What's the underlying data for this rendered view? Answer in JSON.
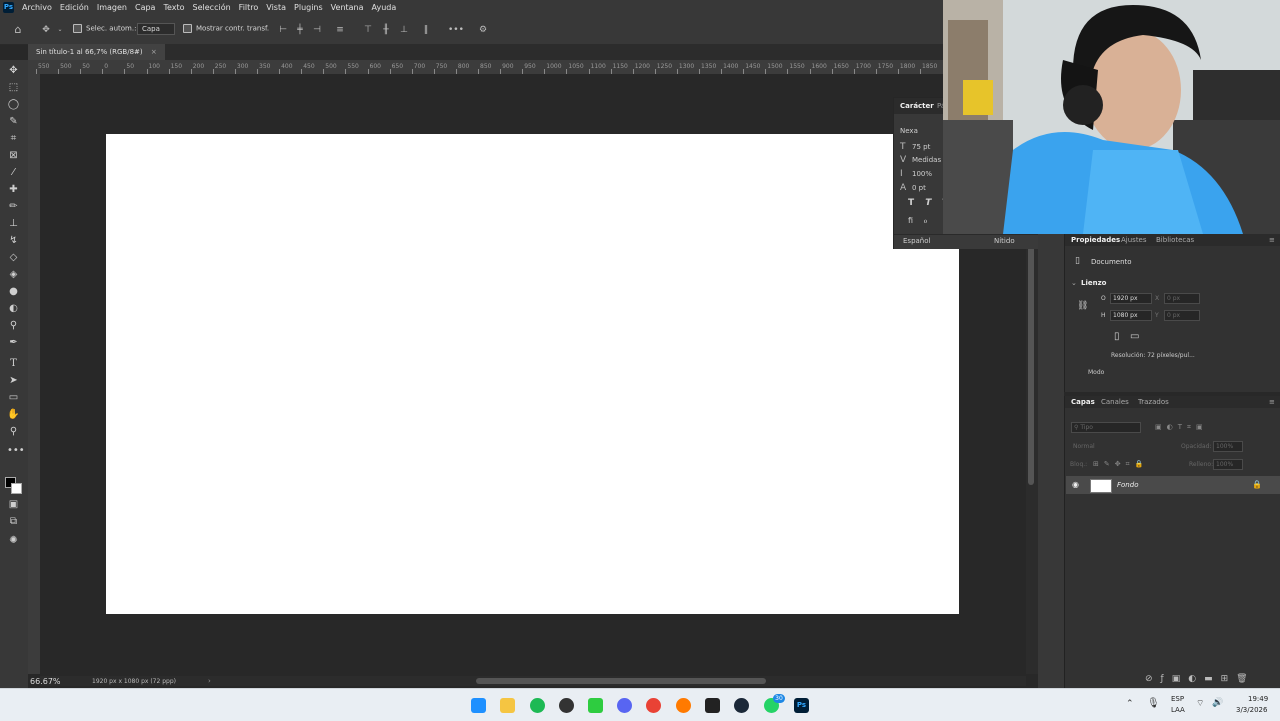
{
  "menubar": {
    "app_icon": "Ps",
    "items": [
      "Archivo",
      "Edición",
      "Imagen",
      "Capa",
      "Texto",
      "Selección",
      "Filtro",
      "Vista",
      "Plugins",
      "Ventana",
      "Ayuda"
    ]
  },
  "options_bar": {
    "auto_select_label": "Selec. autom.:",
    "auto_select_target": "Capa",
    "show_transform_label": "Mostrar contr. transf."
  },
  "document": {
    "tab_title": "Sin título-1 al 66,7% (RGB/8#)",
    "zoom": "66.67%",
    "info": "1920 px x 1080 px (72 ppp)"
  },
  "ruler_labels": [
    "550",
    "500",
    "50",
    "0",
    "50",
    "100",
    "150",
    "200",
    "250",
    "300",
    "350",
    "400",
    "450",
    "500",
    "550",
    "600",
    "650",
    "700",
    "750",
    "800",
    "850",
    "900",
    "950",
    "1000",
    "1050",
    "1100",
    "1150",
    "1200",
    "1250",
    "1300",
    "1350",
    "1400",
    "1450",
    "1500",
    "1550",
    "1600",
    "1650",
    "1700",
    "1750",
    "1800",
    "1850"
  ],
  "character_panel": {
    "tabs": [
      "Carácter",
      "Pá"
    ],
    "font": "Nexa",
    "size": "75 pt",
    "kerning": "Medidas",
    "vertical_scale": "100%",
    "baseline": "0 pt",
    "language": "Español",
    "antialias": "Nítido"
  },
  "properties_panel": {
    "tabs": [
      "Propiedades",
      "Ajustes",
      "Bibliotecas"
    ],
    "doc_label": "Documento",
    "section": "Lienzo",
    "width_label": "O",
    "width": "1920 px",
    "height_label": "H",
    "height": "1080 px",
    "x_label": "X",
    "x_value": "0 px",
    "y_label": "Y",
    "y_value": "0 px",
    "resolution": "Resolución: 72 píxeles/pul...",
    "mode": "Modo"
  },
  "layers_panel": {
    "tabs": [
      "Capas",
      "Canales",
      "Trazados"
    ],
    "search_placeholder": "Tipo",
    "blend_mode": "Normal",
    "opacity_label": "Opacidad:",
    "opacity": "100%",
    "lock_label": "Bloq.:",
    "fill_label": "Relleno:",
    "fill": "100%",
    "layers": [
      {
        "name": "Fondo",
        "visible": true,
        "locked": true
      }
    ]
  },
  "taskbar": {
    "lang_line1": "ESP",
    "lang_line2": "LAA",
    "time": "19:49",
    "date": "3/3/2026",
    "whatsapp_badge": "30",
    "apps": [
      "windows-start",
      "file-explorer",
      "spotify",
      "davinci",
      "nvidia",
      "discord",
      "chrome",
      "firefox",
      "epic-games",
      "steam",
      "whatsapp",
      "photoshop"
    ]
  }
}
